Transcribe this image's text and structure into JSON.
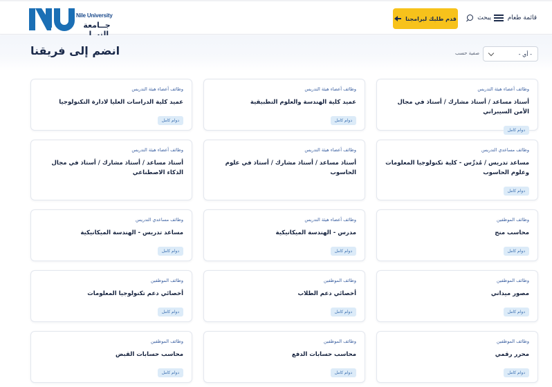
{
  "header": {
    "menu_label": "قائمة طعام",
    "search_label": "يبحث",
    "apply_label": "قدم طلبك لبرامجنا",
    "logo_en": "Nile University",
    "logo_ar": "جــامعة النيــل"
  },
  "page": {
    "title": "انضم إلى فريقنا",
    "filter_label": "صفية حسب",
    "filter_value": "- أي -"
  },
  "colors": {
    "brand_blue": "#1b6fb5",
    "accent_yellow": "#f7c21b",
    "navy": "#1b2a4a"
  },
  "jobs": [
    {
      "category": "وظائف أعضاء هيئة التدريس",
      "title": "أستاذ مساعد / أستاذ مشارك / أستاذ في مجال الأمن السيبراني",
      "type": "دوام كامل"
    },
    {
      "category": "وظائف أعضاء هيئة التدريس",
      "title": "عميد كلية الهندسة والعلوم التطبيقية",
      "type": "دوام كامل"
    },
    {
      "category": "وظائف أعضاء هيئة التدريس",
      "title": "عميد كلية الدراسات العليا لادارة التكنولوجيا",
      "type": "دوام كامل"
    },
    {
      "category": "وظائف مساعدي التدريس",
      "title": "مساعد تدريس / مُدرِّس - كلية تكنولوجيا المعلومات وعلوم الحاسوب",
      "type": "دوام كامل"
    },
    {
      "category": "وظائف أعضاء هيئة التدريس",
      "title": "أستاذ مساعد / أستاذ مشارك / أستاذ في علوم الحاسوب",
      "type": ""
    },
    {
      "category": "وظائف أعضاء هيئة التدريس",
      "title": "أستاذ مساعد / أستاذ مشارك / أستاذ في مجال الذكاء الاصطناعي",
      "type": ""
    },
    {
      "category": "وظائف الموظفين",
      "title": "محاسب منح",
      "type": "دوام كامل"
    },
    {
      "category": "وظائف أعضاء هيئة التدريس",
      "title": "مدرس - الهندسة الميكانيكية",
      "type": "دوام كامل"
    },
    {
      "category": "وظائف مساعدي التدريس",
      "title": "مساعد تدريس - الهندسة الميكانيكية",
      "type": "دوام كامل"
    },
    {
      "category": "وظائف الموظفين",
      "title": "مصور ميداني",
      "type": "دوام كامل"
    },
    {
      "category": "وظائف الموظفين",
      "title": "أخصائي دعم الطلاب",
      "type": "دوام كامل"
    },
    {
      "category": "وظائف الموظفين",
      "title": "أخصائي دعم تكنولوجيا المعلومات",
      "type": "دوام كامل"
    },
    {
      "category": "وظائف الموظفين",
      "title": "محرر رقمي",
      "type": "دوام كامل"
    },
    {
      "category": "وظائف الموظفين",
      "title": "محاسب حسابات الدفع",
      "type": "دوام كامل"
    },
    {
      "category": "وظائف الموظفين",
      "title": "محاسب حسابات القبض",
      "type": "دوام كامل"
    }
  ]
}
